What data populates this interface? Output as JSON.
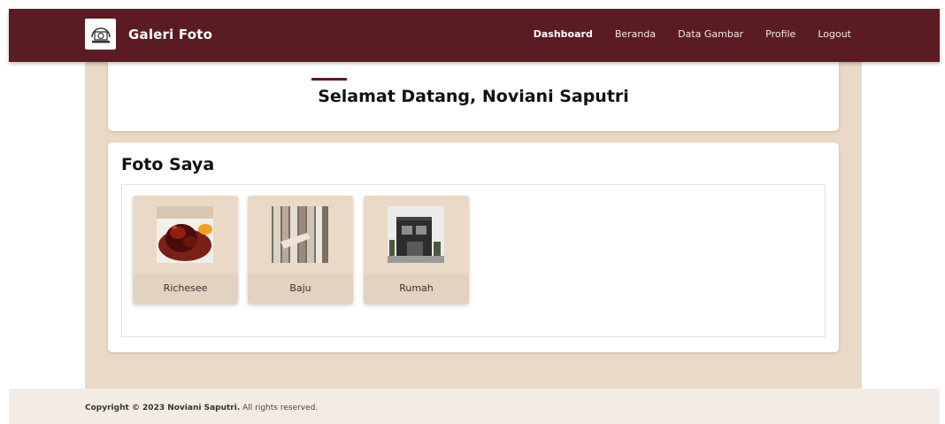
{
  "navbar": {
    "brand": "Galeri Foto",
    "logo_icon": "camera-icon",
    "links": [
      "Dashboard",
      "Beranda",
      "Data Gambar",
      "Profile",
      "Logout"
    ],
    "active": "Dashboard"
  },
  "welcome": {
    "title": "Selamat Datang, Noviani Saputri"
  },
  "photos": {
    "title": "Foto Saya",
    "items": [
      {
        "label": "Richesee"
      },
      {
        "label": "Baju"
      },
      {
        "label": "Rumah"
      }
    ]
  },
  "footer": {
    "copyright": "Copyright © 2023 Noviani Saputri.",
    "rights": "All rights reserved."
  },
  "colors": {
    "navbar": "#5a1c22",
    "content_bg": "#ead9c6",
    "footer_bg": "#f3ece5"
  }
}
